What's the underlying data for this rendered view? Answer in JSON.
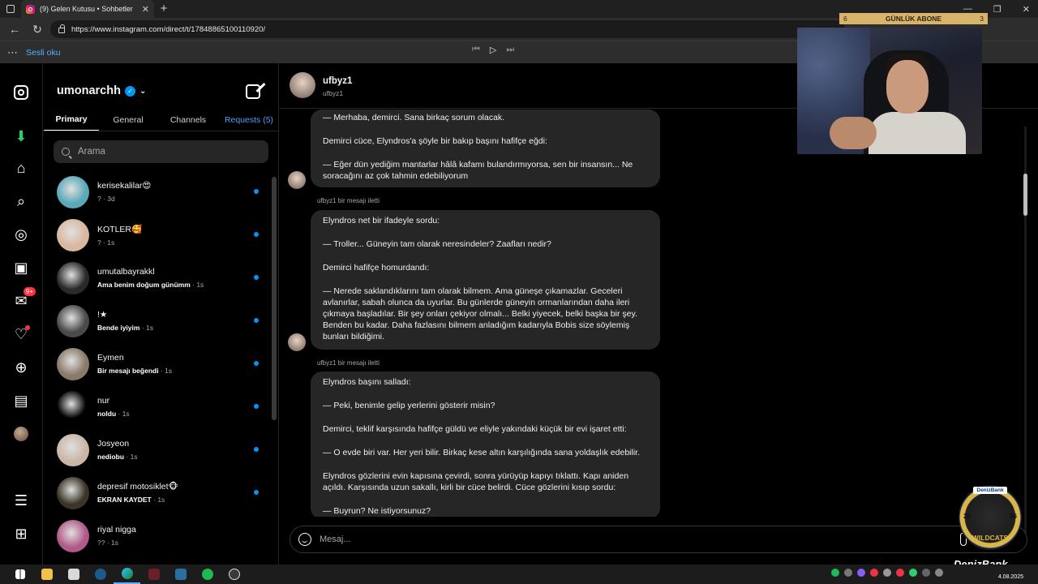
{
  "browser": {
    "tab_title": "(9) Gelen Kutusu • Sohbetler",
    "tab_close": "✕",
    "new_tab": "+",
    "url": "https://www.instagram.com/direct/t/17848865100110920/",
    "read_aloud": "Sesli oku",
    "window_min": "—",
    "window_max": "❐",
    "window_close": "✕"
  },
  "rail": {
    "notifications_badge": "9+"
  },
  "inbox": {
    "username": "umonarchh",
    "tabs": [
      {
        "label": "Primary"
      },
      {
        "label": "General"
      },
      {
        "label": "Channels"
      },
      {
        "label": "Requests (5)"
      }
    ],
    "search_placeholder": "Arama",
    "threads": [
      {
        "name": "kerisekalilar😍",
        "preview": "?",
        "time": "· 3d",
        "bold": false,
        "unread": true,
        "color": "#5aa9b8"
      },
      {
        "name": "KOTLER🥰",
        "preview": "?",
        "time": "· 1s",
        "bold": false,
        "unread": true,
        "color": "#d9b8a0"
      },
      {
        "name": "umutalbayrakkl",
        "preview": "Ama benim doğum günümm",
        "time": "· 1s",
        "bold": true,
        "unread": true,
        "color": "#2a2a2a"
      },
      {
        "name": "!★",
        "preview": "Bende iyiyim",
        "time": "· 1s",
        "bold": true,
        "unread": true,
        "color": "#4a4a4a"
      },
      {
        "name": "Eymen",
        "preview": "Bir mesajı beğendi",
        "time": "· 1s",
        "bold": true,
        "unread": true,
        "color": "#8a7a6a"
      },
      {
        "name": "nur",
        "preview": "noldu",
        "time": "· 1s",
        "bold": true,
        "unread": true,
        "color": "#000000"
      },
      {
        "name": "Josyeon",
        "preview": "nediobu",
        "time": "· 1s",
        "bold": true,
        "unread": true,
        "color": "#cbb6a6"
      },
      {
        "name": "depresif motosiklet🐵",
        "preview": "EKRAN KAYDET",
        "time": "· 1s",
        "bold": true,
        "unread": true,
        "color": "#3a3527"
      },
      {
        "name": "riyal nigga",
        "preview": "??",
        "time": "· 1s",
        "bold": false,
        "unread": false,
        "color": "#b05a8a"
      }
    ]
  },
  "chat": {
    "name": "ufbyz1",
    "handle": "ufbyz1",
    "forward_label": "ufbyz1 bir mesajı iletti",
    "messages": [
      {
        "paragraphs": [
          "— Merhaba, demirci. Sana birkaç sorum olacak.",
          "Demirci cüce, Elyndros'a şöyle bir bakıp başını hafifçe eğdi:",
          "— Eğer dün yediğim mantarlar hâlâ kafamı bulandırmıyorsa, sen bir insansın... Ne soracağını az çok tahmin edebiliyorum"
        ]
      },
      {
        "paragraphs": [
          "Elyndros net bir ifadeyle sordu:",
          "— Troller... Güneyin tam olarak neresindeler? Zaafları nedir?",
          "Demirci hafifçe homurdandı:",
          "— Nerede saklandıklarını tam olarak bilmem. Ama güneşe çıkamazlar. Geceleri avlanırlar, sabah olunca da uyurlar. Bu günlerde güneyin ormanlarından daha ileri çıkmaya başladılar. Bir şey onları çekiyor olmalı... Belki yiyecek, belki başka bir şey. Benden bu kadar. Daha fazlasını bilmem anladığım kadarıyla Bobis size söylemiş bunları bildiğimi."
        ]
      },
      {
        "paragraphs": [
          "Elyndros başını salladı:",
          "— Peki, benimle gelip yerlerini gösterir misin?",
          "Demirci, teklif karşısında hafifçe güldü ve eliyle yakındaki küçük bir evi işaret etti:",
          "— O evde biri var. Her yeri bilir. Birkaç kese altın karşılığında sana yoldaşlık edebilir.",
          "Elyndros gözlerini evin kapısına çevirdi, sonra yürüyüp kapıyı tıklattı. Kapı aniden açıldı. Karşısında uzun sakallı, kirli bir cüce belirdi. Cüce gözlerini kısıp sordu:",
          "— Buyrun? Ne istiyorsunuz?"
        ]
      }
    ],
    "composer_placeholder": "Mesaj..."
  },
  "overlay": {
    "abone_left": "6",
    "abone_label": "GÜNLÜK ABONE",
    "abone_right": "3",
    "badge_brand": "DenizBank",
    "badge_year_left": "20",
    "badge_year_right": "06",
    "badge_team": "WILDCATS",
    "brand_text": "DenizBank"
  },
  "taskbar": {
    "date": "4.08.2025"
  },
  "colors": {
    "accent": "#0095f6",
    "bubble": "#262626",
    "notification": "#ff3040"
  }
}
